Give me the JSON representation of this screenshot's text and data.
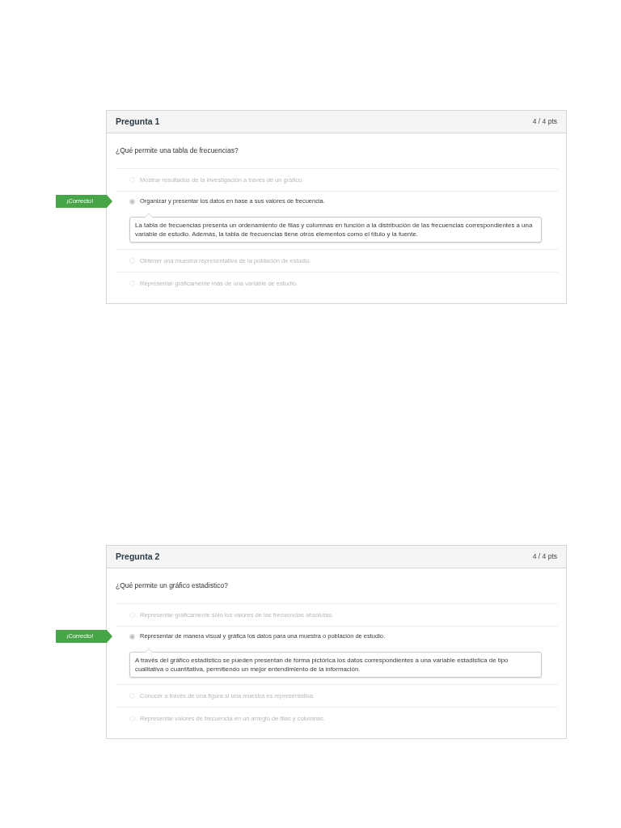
{
  "questions": [
    {
      "title": "Pregunta 1",
      "points": "4 / 4 pts",
      "prompt": "¿Qué permite una tabla de frecuencias?",
      "answers": [
        {
          "text": "Mostrar resultados de la investigación a través de un gráfico.",
          "selected": false
        },
        {
          "text": "Organizar y presentar los datos en base a sus valores de frecuencia.",
          "selected": true,
          "badge": "¡Correcto!",
          "feedback": "La tabla de frecuencias presenta un ordenamiento de filas y columnas en función a la distribución de las frecuencias correspondientes a una variable de estudio. Además, la tabla de frecuencias tiene otros elementos como el título y la fuente."
        },
        {
          "text": "Obtener una muestra representativa de la población de estudio.",
          "selected": false
        },
        {
          "text": "Representar gráficamente más de una variable de estudio.",
          "selected": false
        }
      ]
    },
    {
      "title": "Pregunta 2",
      "points": "4 / 4 pts",
      "prompt": "¿Qué permite un gráfico estadistico?",
      "answers": [
        {
          "text": "Representar gráficamente sólo los valores de las frecuencias absolutas.",
          "selected": false
        },
        {
          "text": "Representar de manera visual y gráfica los datos para una muestra o población de estudio.",
          "selected": true,
          "badge": "¡Correcto!",
          "feedback": "A través del gráfico estadistico se pueden presentan de forma pictórica los datos correspondientes a una variable estadistica de tipo cualitativa o cuantitativa, permitiendo un mejor entendimiento de la información."
        },
        {
          "text": "Conocer a través de una figura si una muestra es representativa.",
          "selected": false
        },
        {
          "text": "Representar valores de frecuencia en un arreglo de filas y columnas.",
          "selected": false
        }
      ]
    }
  ]
}
